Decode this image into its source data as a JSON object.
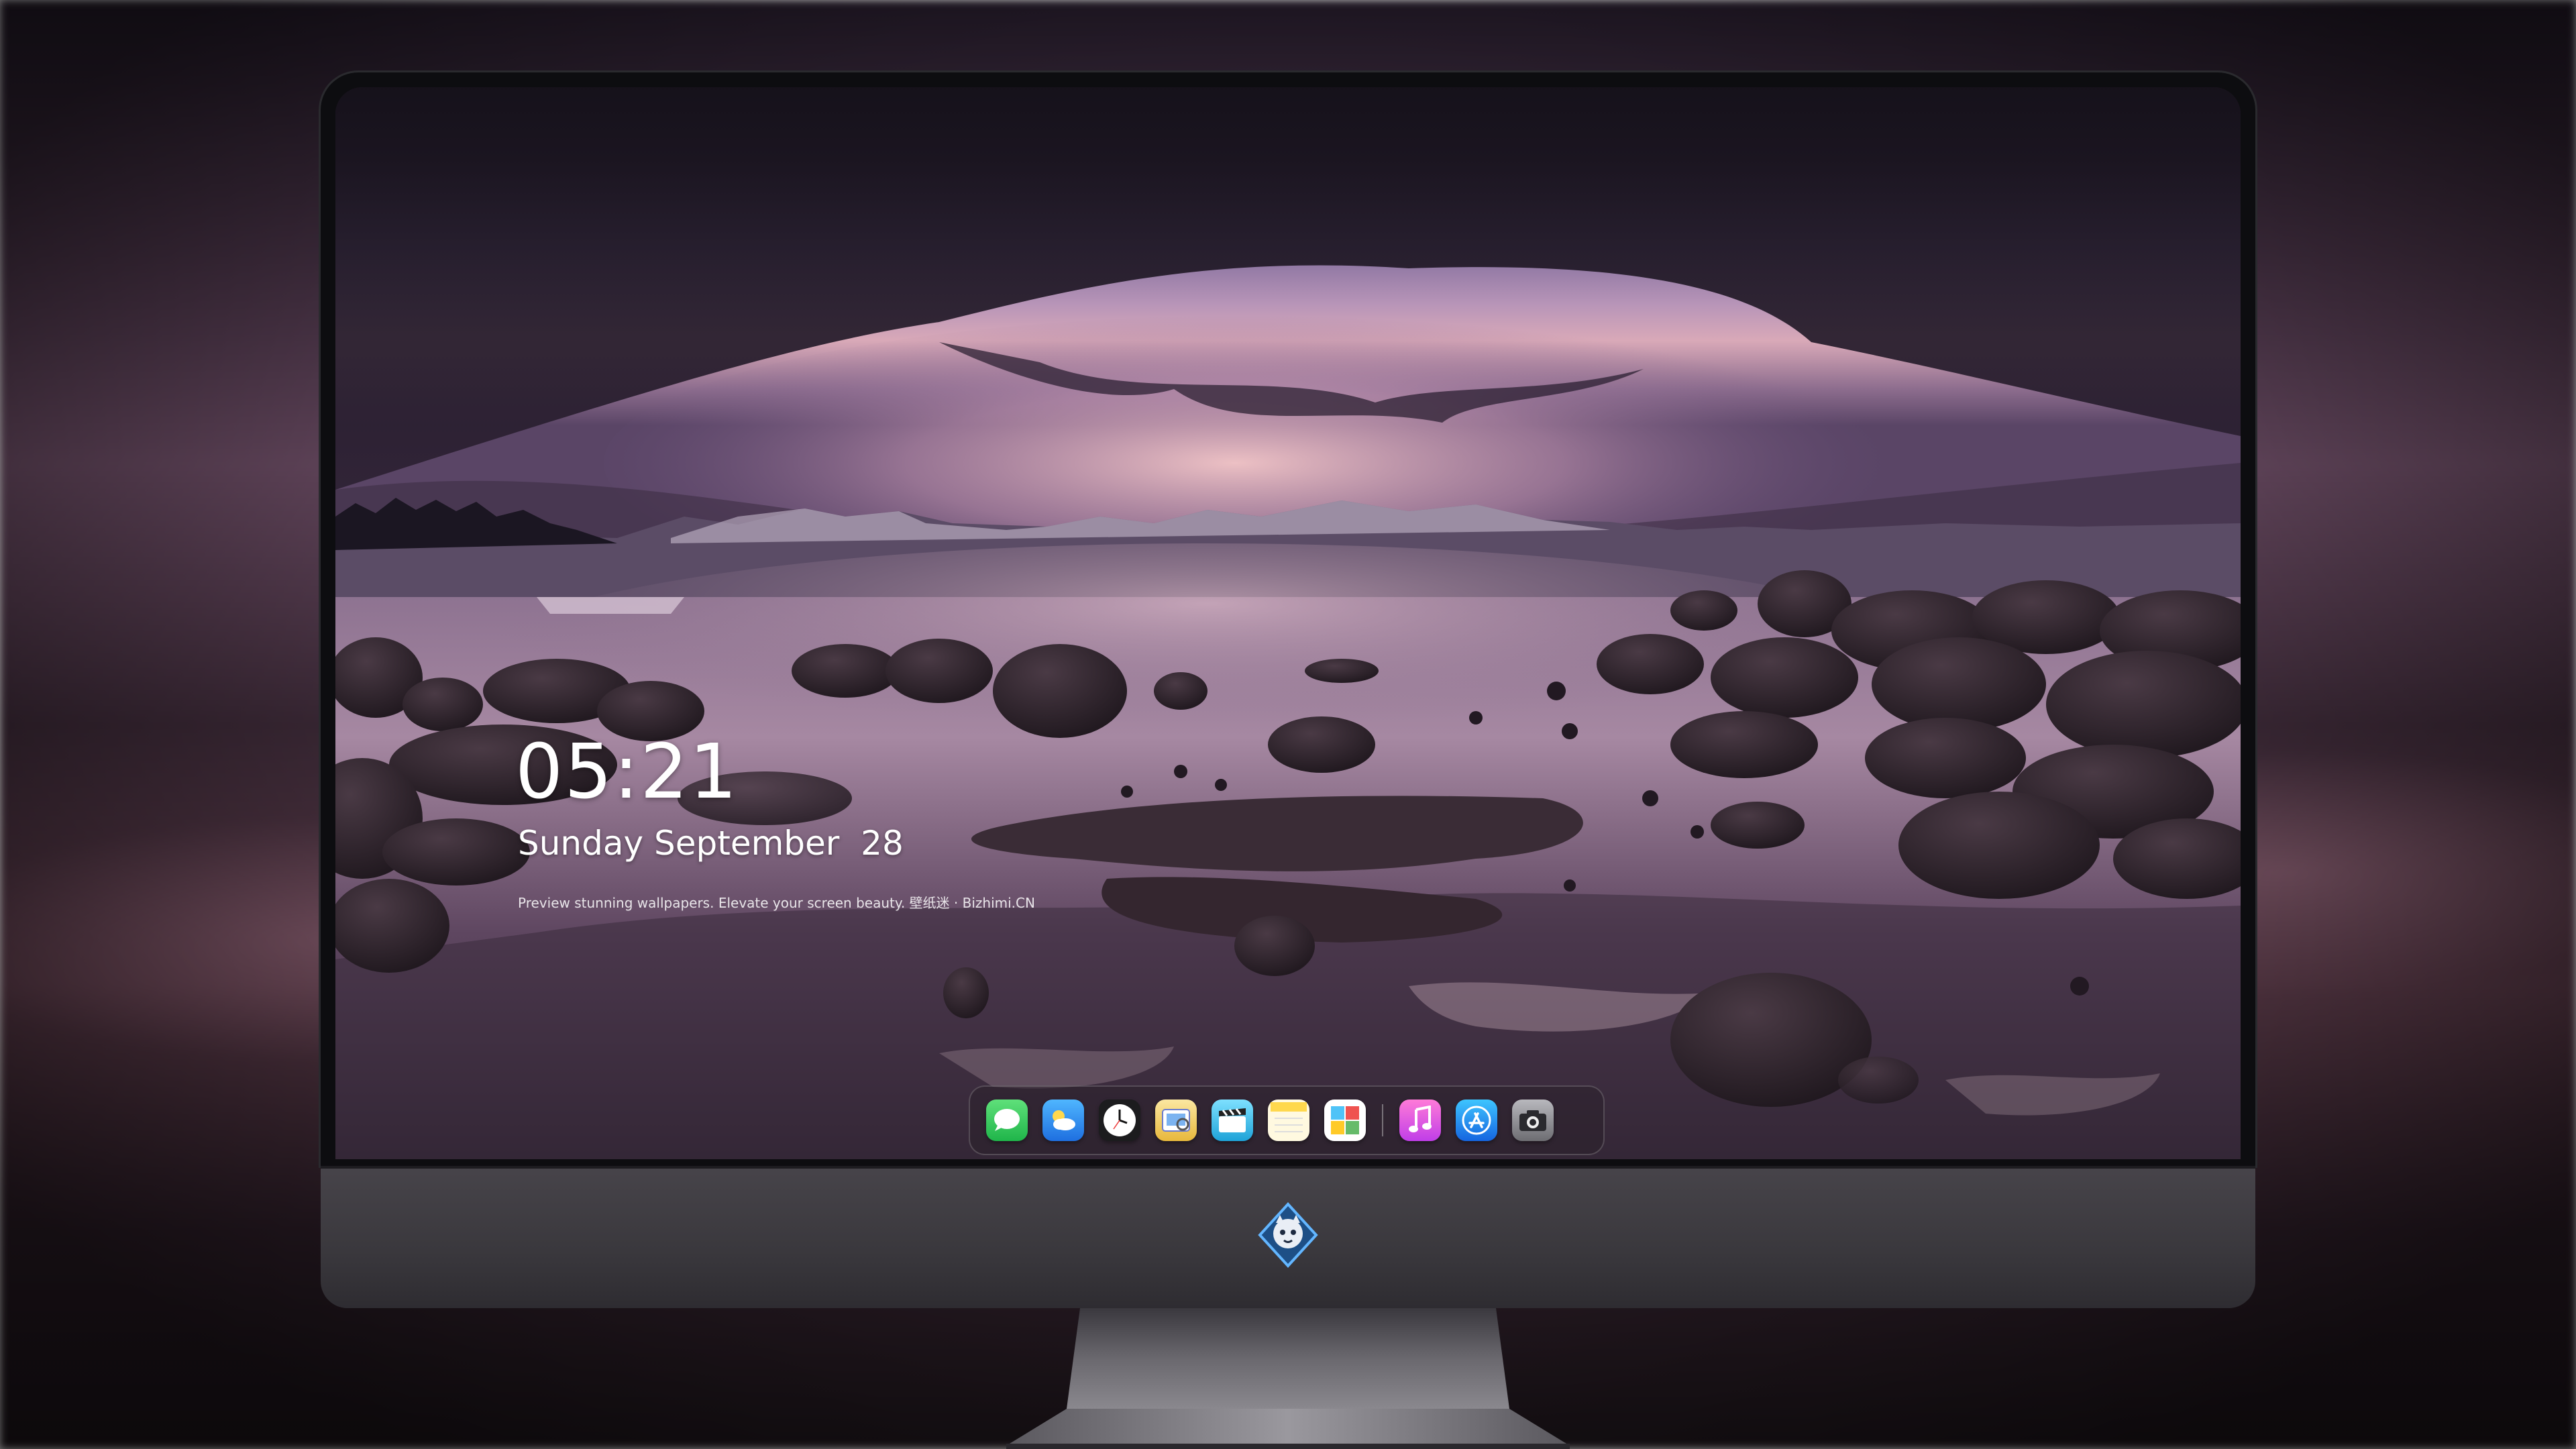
{
  "lockscreen": {
    "time": "05:21",
    "date": "Sunday September  28",
    "caption": "Preview stunning wallpapers. Elevate your screen beauty. 壁纸迷 · Bizhimi.CN"
  },
  "dock": {
    "apps": [
      {
        "name": "messages-icon",
        "color": "#34c759"
      },
      {
        "name": "weather-icon",
        "color": "#2f8dff"
      },
      {
        "name": "clock-icon",
        "color": "#ffffff"
      },
      {
        "name": "preview-icon",
        "color": "#e8c14a"
      },
      {
        "name": "clips-icon",
        "color": "#39b8e6"
      },
      {
        "name": "notes-icon",
        "color": "#ffd84d"
      },
      {
        "name": "photo-booth-icon",
        "color": "#e85d4a"
      },
      {
        "name": "music-icon",
        "color": "#e84fe6"
      },
      {
        "name": "app-store-icon",
        "color": "#1c8cff"
      },
      {
        "name": "camera-icon",
        "color": "#8a8a8e"
      }
    ]
  },
  "colors": {
    "wallpaper_sky": "#6e5a8a",
    "wallpaper_glow": "#e8b7c8",
    "water": "#7a5f7e",
    "rock": "#2a2028"
  }
}
